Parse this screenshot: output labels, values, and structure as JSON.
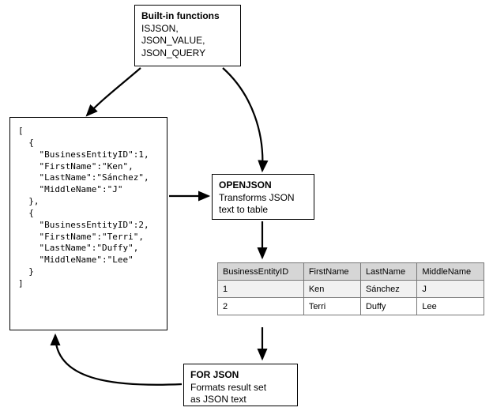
{
  "builtin": {
    "title": "Built-in functions",
    "lines": [
      "ISJSON,",
      "JSON_VALUE,",
      "JSON_QUERY"
    ]
  },
  "openjson": {
    "title": "OPENJSON",
    "desc1": "Transforms JSON",
    "desc2": "text to table"
  },
  "forjson": {
    "title": "FOR JSON",
    "desc1": "Formats result set",
    "desc2": "as JSON text"
  },
  "json_snippet": "[\n  {\n    \"BusinessEntityID\":1,\n    \"FirstName\":\"Ken\",\n    \"LastName\":\"Sánchez\",\n    \"MiddleName\":\"J\"\n  },\n  {\n    \"BusinessEntityID\":2,\n    \"FirstName\":\"Terri\",\n    \"LastName\":\"Duffy\",\n    \"MiddleName\":\"Lee\"\n  }\n]",
  "table": {
    "headers": {
      "c0": "BusinessEntityID",
      "c1": "FirstName",
      "c2": "LastName",
      "c3": "MiddleName"
    },
    "rows": [
      {
        "c0": "1",
        "c1": "Ken",
        "c2": "Sánchez",
        "c3": "J"
      },
      {
        "c0": "2",
        "c1": "Terri",
        "c2": "Duffy",
        "c3": "Lee"
      }
    ]
  }
}
